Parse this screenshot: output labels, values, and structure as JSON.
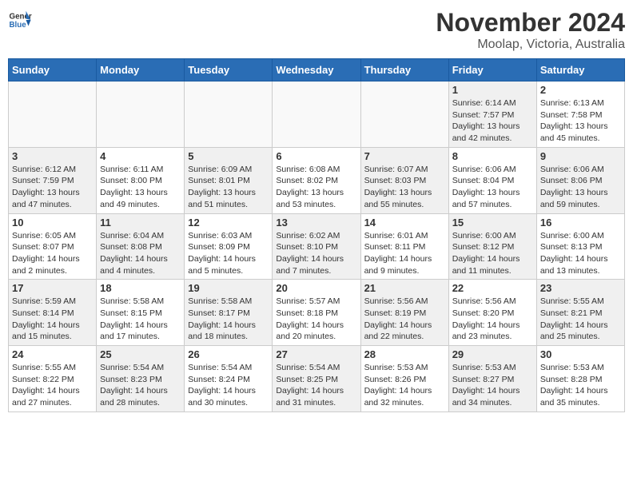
{
  "logo": {
    "line1": "General",
    "line2": "Blue"
  },
  "title": "November 2024",
  "location": "Moolap, Victoria, Australia",
  "weekdays": [
    "Sunday",
    "Monday",
    "Tuesday",
    "Wednesday",
    "Thursday",
    "Friday",
    "Saturday"
  ],
  "weeks": [
    [
      {
        "day": "",
        "info": ""
      },
      {
        "day": "",
        "info": ""
      },
      {
        "day": "",
        "info": ""
      },
      {
        "day": "",
        "info": ""
      },
      {
        "day": "",
        "info": ""
      },
      {
        "day": "1",
        "info": "Sunrise: 6:14 AM\nSunset: 7:57 PM\nDaylight: 13 hours\nand 42 minutes."
      },
      {
        "day": "2",
        "info": "Sunrise: 6:13 AM\nSunset: 7:58 PM\nDaylight: 13 hours\nand 45 minutes."
      }
    ],
    [
      {
        "day": "3",
        "info": "Sunrise: 6:12 AM\nSunset: 7:59 PM\nDaylight: 13 hours\nand 47 minutes."
      },
      {
        "day": "4",
        "info": "Sunrise: 6:11 AM\nSunset: 8:00 PM\nDaylight: 13 hours\nand 49 minutes."
      },
      {
        "day": "5",
        "info": "Sunrise: 6:09 AM\nSunset: 8:01 PM\nDaylight: 13 hours\nand 51 minutes."
      },
      {
        "day": "6",
        "info": "Sunrise: 6:08 AM\nSunset: 8:02 PM\nDaylight: 13 hours\nand 53 minutes."
      },
      {
        "day": "7",
        "info": "Sunrise: 6:07 AM\nSunset: 8:03 PM\nDaylight: 13 hours\nand 55 minutes."
      },
      {
        "day": "8",
        "info": "Sunrise: 6:06 AM\nSunset: 8:04 PM\nDaylight: 13 hours\nand 57 minutes."
      },
      {
        "day": "9",
        "info": "Sunrise: 6:06 AM\nSunset: 8:06 PM\nDaylight: 13 hours\nand 59 minutes."
      }
    ],
    [
      {
        "day": "10",
        "info": "Sunrise: 6:05 AM\nSunset: 8:07 PM\nDaylight: 14 hours\nand 2 minutes."
      },
      {
        "day": "11",
        "info": "Sunrise: 6:04 AM\nSunset: 8:08 PM\nDaylight: 14 hours\nand 4 minutes."
      },
      {
        "day": "12",
        "info": "Sunrise: 6:03 AM\nSunset: 8:09 PM\nDaylight: 14 hours\nand 5 minutes."
      },
      {
        "day": "13",
        "info": "Sunrise: 6:02 AM\nSunset: 8:10 PM\nDaylight: 14 hours\nand 7 minutes."
      },
      {
        "day": "14",
        "info": "Sunrise: 6:01 AM\nSunset: 8:11 PM\nDaylight: 14 hours\nand 9 minutes."
      },
      {
        "day": "15",
        "info": "Sunrise: 6:00 AM\nSunset: 8:12 PM\nDaylight: 14 hours\nand 11 minutes."
      },
      {
        "day": "16",
        "info": "Sunrise: 6:00 AM\nSunset: 8:13 PM\nDaylight: 14 hours\nand 13 minutes."
      }
    ],
    [
      {
        "day": "17",
        "info": "Sunrise: 5:59 AM\nSunset: 8:14 PM\nDaylight: 14 hours\nand 15 minutes."
      },
      {
        "day": "18",
        "info": "Sunrise: 5:58 AM\nSunset: 8:15 PM\nDaylight: 14 hours\nand 17 minutes."
      },
      {
        "day": "19",
        "info": "Sunrise: 5:58 AM\nSunset: 8:17 PM\nDaylight: 14 hours\nand 18 minutes."
      },
      {
        "day": "20",
        "info": "Sunrise: 5:57 AM\nSunset: 8:18 PM\nDaylight: 14 hours\nand 20 minutes."
      },
      {
        "day": "21",
        "info": "Sunrise: 5:56 AM\nSunset: 8:19 PM\nDaylight: 14 hours\nand 22 minutes."
      },
      {
        "day": "22",
        "info": "Sunrise: 5:56 AM\nSunset: 8:20 PM\nDaylight: 14 hours\nand 23 minutes."
      },
      {
        "day": "23",
        "info": "Sunrise: 5:55 AM\nSunset: 8:21 PM\nDaylight: 14 hours\nand 25 minutes."
      }
    ],
    [
      {
        "day": "24",
        "info": "Sunrise: 5:55 AM\nSunset: 8:22 PM\nDaylight: 14 hours\nand 27 minutes."
      },
      {
        "day": "25",
        "info": "Sunrise: 5:54 AM\nSunset: 8:23 PM\nDaylight: 14 hours\nand 28 minutes."
      },
      {
        "day": "26",
        "info": "Sunrise: 5:54 AM\nSunset: 8:24 PM\nDaylight: 14 hours\nand 30 minutes."
      },
      {
        "day": "27",
        "info": "Sunrise: 5:54 AM\nSunset: 8:25 PM\nDaylight: 14 hours\nand 31 minutes."
      },
      {
        "day": "28",
        "info": "Sunrise: 5:53 AM\nSunset: 8:26 PM\nDaylight: 14 hours\nand 32 minutes."
      },
      {
        "day": "29",
        "info": "Sunrise: 5:53 AM\nSunset: 8:27 PM\nDaylight: 14 hours\nand 34 minutes."
      },
      {
        "day": "30",
        "info": "Sunrise: 5:53 AM\nSunset: 8:28 PM\nDaylight: 14 hours\nand 35 minutes."
      }
    ]
  ]
}
